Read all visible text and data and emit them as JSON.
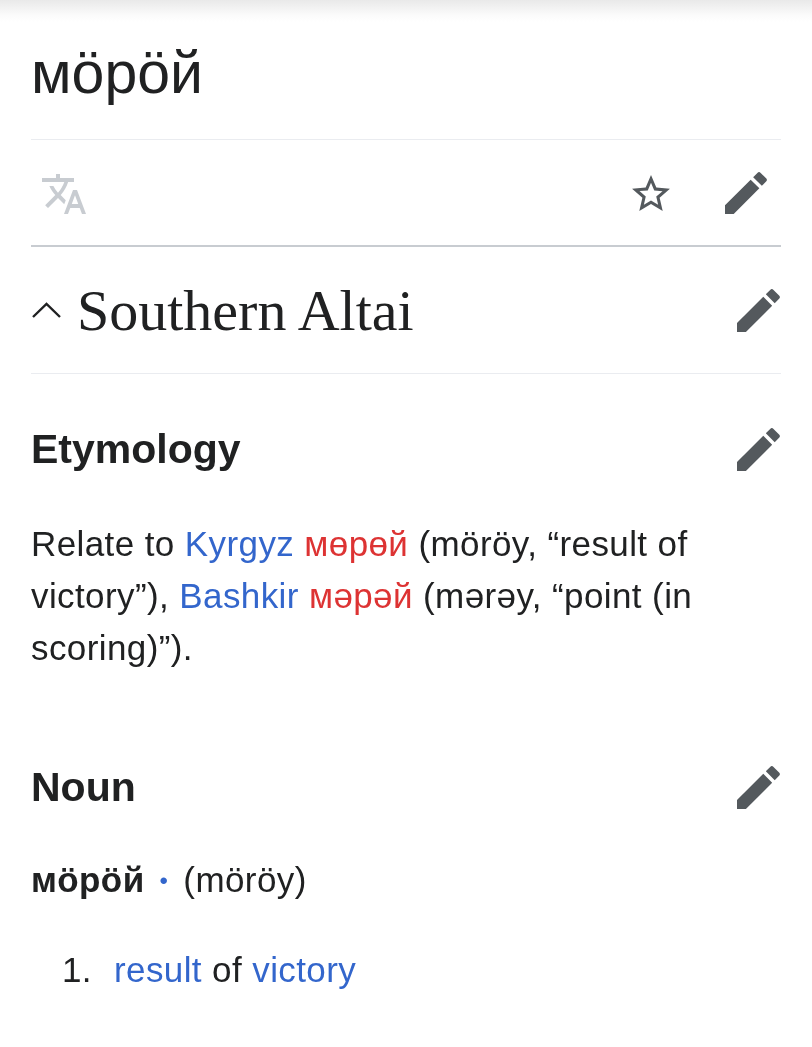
{
  "page": {
    "title": "мӧрӧй"
  },
  "toolbar": {
    "translate": {
      "disabled": true
    },
    "bookmark": {
      "starred": false
    }
  },
  "entry": {
    "language": "Southern Altai",
    "expanded": true,
    "sections": [
      {
        "kind": "etymology",
        "heading": "Etymology",
        "text": [
          {
            "kind": "plain",
            "text": "Relate to "
          },
          {
            "kind": "link",
            "text": "Kyrgyz"
          },
          {
            "kind": "new_link",
            "text": "мөрөй"
          },
          {
            "kind": "plain",
            "text": " (möröy, “result of victory”), "
          },
          {
            "kind": "link",
            "text": "Bashkir"
          },
          {
            "kind": "new_link",
            "text": "мәрәй"
          },
          {
            "kind": "plain",
            "text": " (mərəy, “point (in scoring)”)."
          }
        ]
      },
      {
        "kind": "part_of_speech",
        "heading": "Noun",
        "headword": "мӧрӧй",
        "separator": "•",
        "transliteration": "(möröy)",
        "definitions": [
          {
            "number": "1.",
            "text": [
              {
                "kind": "link",
                "text": "result"
              },
              {
                "kind": "plain",
                "text": " of "
              },
              {
                "kind": "link",
                "text": "victory"
              }
            ]
          }
        ]
      }
    ]
  }
}
